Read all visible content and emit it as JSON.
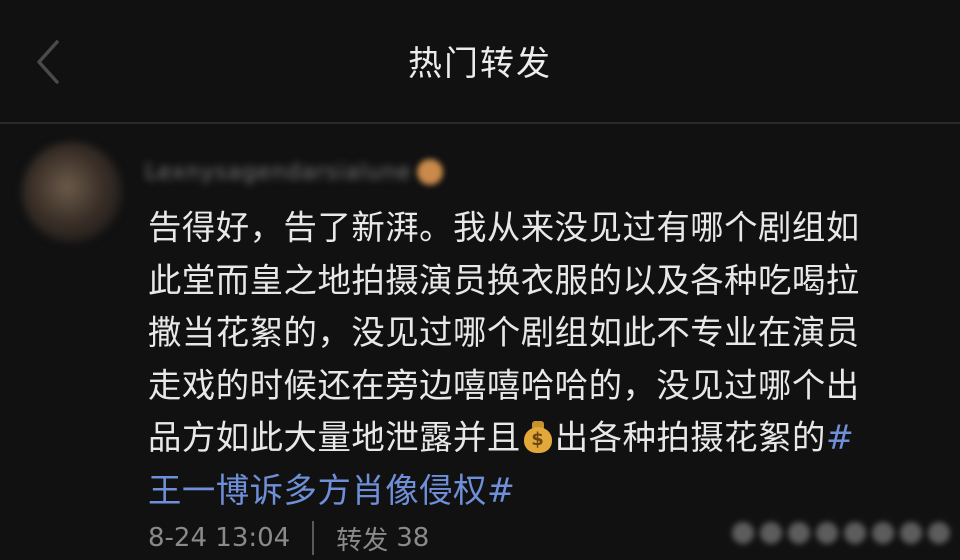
{
  "header": {
    "title": "热门转发"
  },
  "post": {
    "author": "Lexnysagendarsialune",
    "text_lines": [
      "告得好，告了新湃。我从来没见过有哪个剧组如",
      "此堂而皇之地拍摄演员换衣服的以及各种吃喝拉",
      "撒当花絮的，没见过哪个剧组如此不专业在演员",
      "走戏的时候还在旁边嘻嘻哈哈的，没见过哪个出",
      "品方如此大量地泄露并且"
    ],
    "text_after_emoji": "出各种拍摄花絮的",
    "hashtag_open": "#",
    "hashtag_text": "王一博诉多方肖像侵权#",
    "emoji_icon": "money-bag-icon",
    "timestamp": "8-24 13:04",
    "forward_label": "转发",
    "forward_count": "38"
  },
  "colors": {
    "background": "#111112",
    "text": "#e8e8e8",
    "hashtag": "#6f8fd8",
    "meta": "#8a8a8a"
  }
}
